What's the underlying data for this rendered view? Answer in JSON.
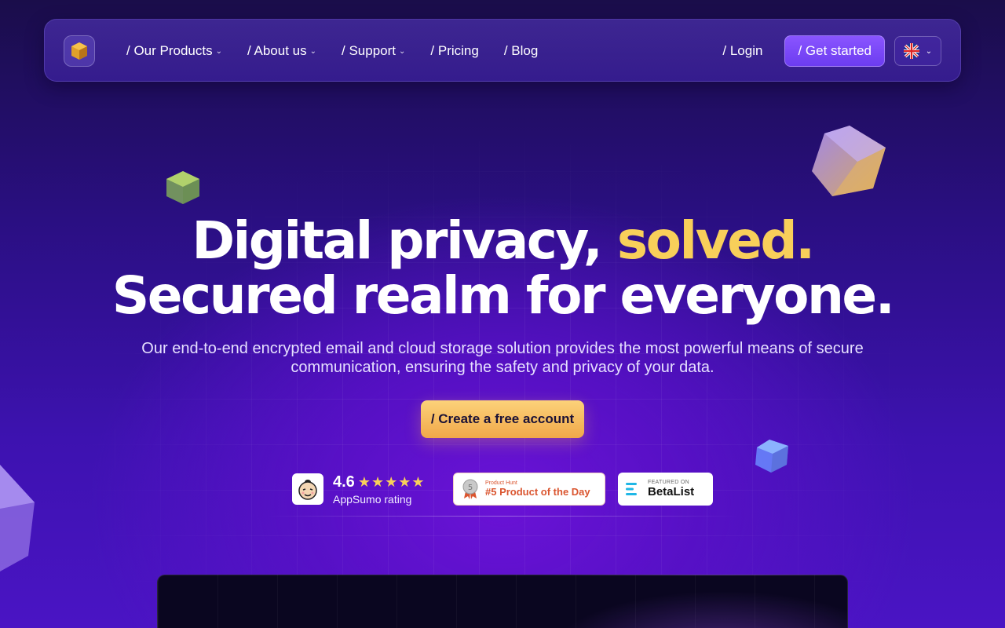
{
  "nav": {
    "items": [
      {
        "label": "/ Our Products",
        "has_dropdown": true
      },
      {
        "label": "/ About us",
        "has_dropdown": true
      },
      {
        "label": "/ Support",
        "has_dropdown": true
      },
      {
        "label": "/ Pricing",
        "has_dropdown": false
      },
      {
        "label": "/ Blog",
        "has_dropdown": false
      }
    ],
    "login": "/ Login",
    "get_started": "/ Get started",
    "language_icon": "uk-flag-icon"
  },
  "hero": {
    "title_part1": "Digital privacy, ",
    "title_accent": "solved.",
    "title_line2": "Secured realm for everyone.",
    "subtitle": "Our end-to-end encrypted email and cloud storage solution provides the most powerful means of secure communication, ensuring the safety and privacy of your data.",
    "cta": "/ Create a free account"
  },
  "badges": {
    "appsumo": {
      "rating": "4.6",
      "stars": "★★★★★",
      "label": "AppSumo rating"
    },
    "producthunt": {
      "small": "Product Hunt",
      "big": "#5 Product of the Day"
    },
    "betalist": {
      "small": "FEATURED ON",
      "big": "BetaList"
    }
  },
  "colors": {
    "accent_yellow": "#f8cf5a",
    "primary_purple": "#7b46fb",
    "cta_orange": "#f5b95a"
  }
}
